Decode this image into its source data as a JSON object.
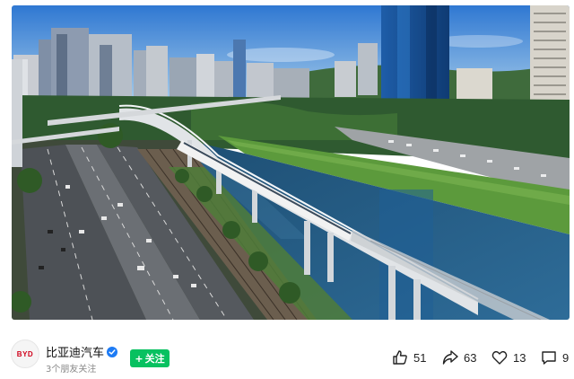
{
  "post": {
    "author": {
      "name": "比亚迪汽车",
      "verified": true,
      "friends_following": "3个朋友关注",
      "avatar_logo_text": "BYD"
    },
    "follow_button": {
      "label": "关注",
      "color": "#07c160"
    },
    "stats": {
      "likes": "51",
      "shares": "63",
      "favorites": "13",
      "comments": "9"
    }
  },
  "colors": {
    "verified_badge": "#1d7bf5",
    "logo_red": "#d0021b"
  },
  "icons": [
    "thumbs-up-icon",
    "share-icon",
    "heart-icon",
    "comment-icon",
    "checkmark-icon",
    "plus-icon"
  ]
}
